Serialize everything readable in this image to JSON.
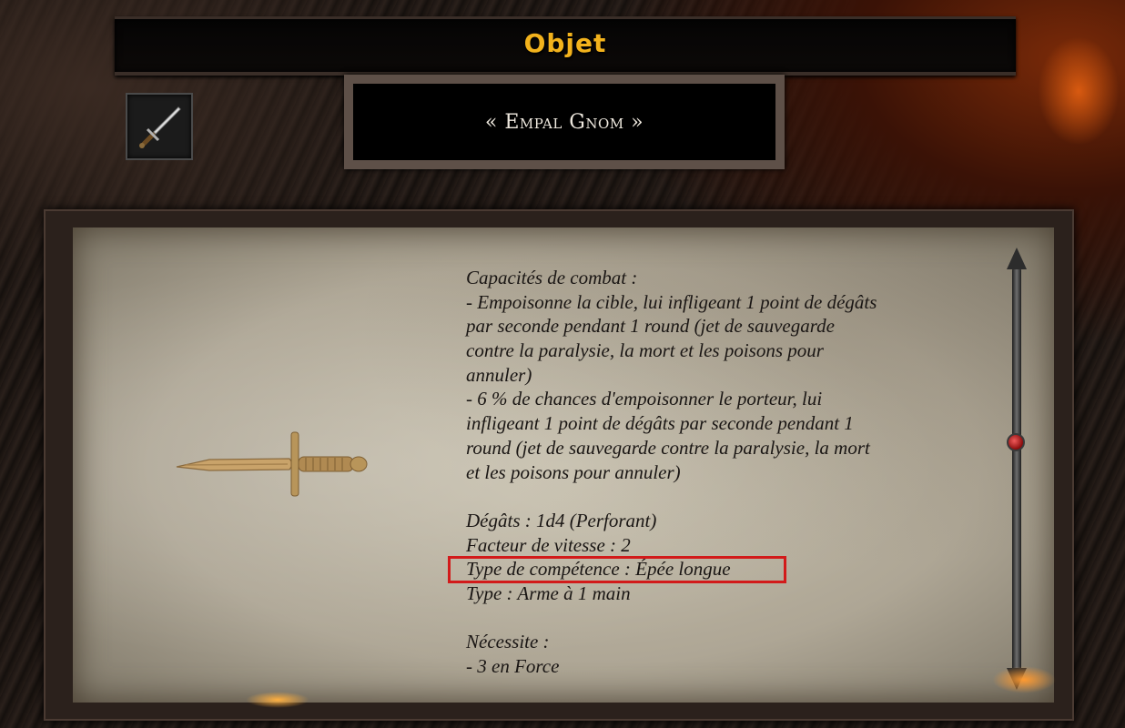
{
  "window": {
    "title": "Objet"
  },
  "item": {
    "icon": "dagger-icon",
    "name": "« Empal Gnom »",
    "image": "dagger-illustration"
  },
  "description": {
    "lines": [
      "Capacités de combat :",
      "- Empoisonne la cible, lui infligeant 1 point de dégâts",
      "par seconde pendant 1 round (jet de sauvegarde",
      "contre la paralysie, la mort et les poisons pour",
      "annuler)",
      "- 6 % de chances d'empoisonner le porteur, lui",
      "infligeant 1 point de dégâts par seconde pendant 1",
      "round (jet de sauvegarde contre la paralysie, la mort",
      "et les poisons pour annuler)",
      "",
      "Dégâts : 1d4 (Perforant)",
      "Facteur de vitesse : 2",
      "Type de compétence : Épée longue",
      "Type : Arme à 1 main",
      "",
      "Nécessite :",
      "- 3 en Force"
    ],
    "highlighted_line": "Type de compétence : Épée longue"
  },
  "colors": {
    "title": "#f2b21c",
    "highlight": "#d21a1a",
    "text": "#1a1614"
  }
}
